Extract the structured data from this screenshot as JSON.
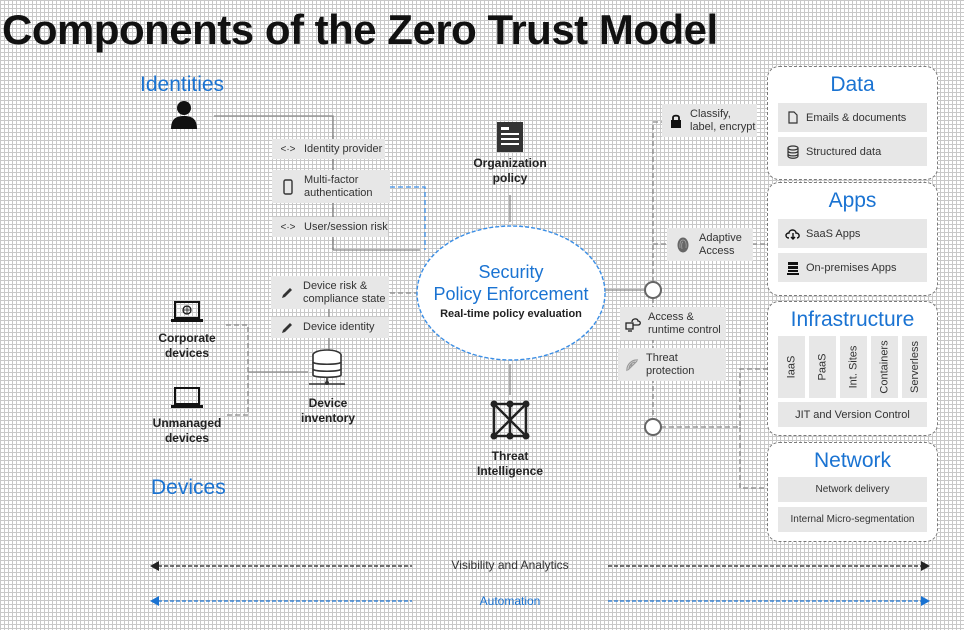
{
  "title": "Components of the Zero Trust Model",
  "identities": {
    "heading": "Identities",
    "chips": [
      {
        "icon": "code-brackets-icon",
        "label": "Identity provider"
      },
      {
        "icon": "phone-icon",
        "label": "Multi-factor\nauthentication"
      },
      {
        "icon": "code-brackets-icon",
        "label": "User/session risk"
      }
    ]
  },
  "devices": {
    "heading": "Devices",
    "corporate": "Corporate\ndevices",
    "unmanaged": "Unmanaged\ndevices",
    "inventory": "Device\ninventory",
    "chips": [
      {
        "icon": "pencil-icon",
        "label": "Device risk &\ncompliance state"
      },
      {
        "icon": "pencil-icon",
        "label": "Device identity"
      }
    ]
  },
  "center": {
    "org_policy": "Organization\npolicy",
    "spe_line1": "Security",
    "spe_line2": "Policy Enforcement",
    "spe_sub": "Real-time policy evaluation",
    "threat_intel": "Threat\nIntelligence"
  },
  "controls": [
    {
      "icon": "lock-icon",
      "label": "Classify,\nlabel, encrypt"
    },
    {
      "icon": "fingerprint-icon",
      "label": "Adaptive\nAccess"
    },
    {
      "icon": "cloud-devices-icon",
      "label": "Access &\nruntime control"
    },
    {
      "icon": "radar-icon",
      "label": "Threat\nprotection"
    }
  ],
  "resources": {
    "data": {
      "title": "Data",
      "items": [
        {
          "icon": "document-icon",
          "label": "Emails & documents"
        },
        {
          "icon": "database-icon",
          "label": "Structured data"
        }
      ]
    },
    "apps": {
      "title": "Apps",
      "items": [
        {
          "icon": "cloud-download-icon",
          "label": "SaaS Apps"
        },
        {
          "icon": "server-icon",
          "label": "On-premises Apps"
        }
      ]
    },
    "infrastructure": {
      "title": "Infrastructure",
      "columns": [
        "IaaS",
        "PaaS",
        "Int. Sites",
        "Containers",
        "Serverless"
      ],
      "footer": "JIT and Version Control"
    },
    "network": {
      "title": "Network",
      "items": [
        "Network delivery",
        "Internal Micro-segmentation"
      ]
    }
  },
  "bottom": {
    "visibility": "Visibility and Analytics",
    "automation": "Automation"
  },
  "colors": {
    "accent": "#1a73d2",
    "chip": "#e7e7e7",
    "line": "#7a7a7a"
  }
}
